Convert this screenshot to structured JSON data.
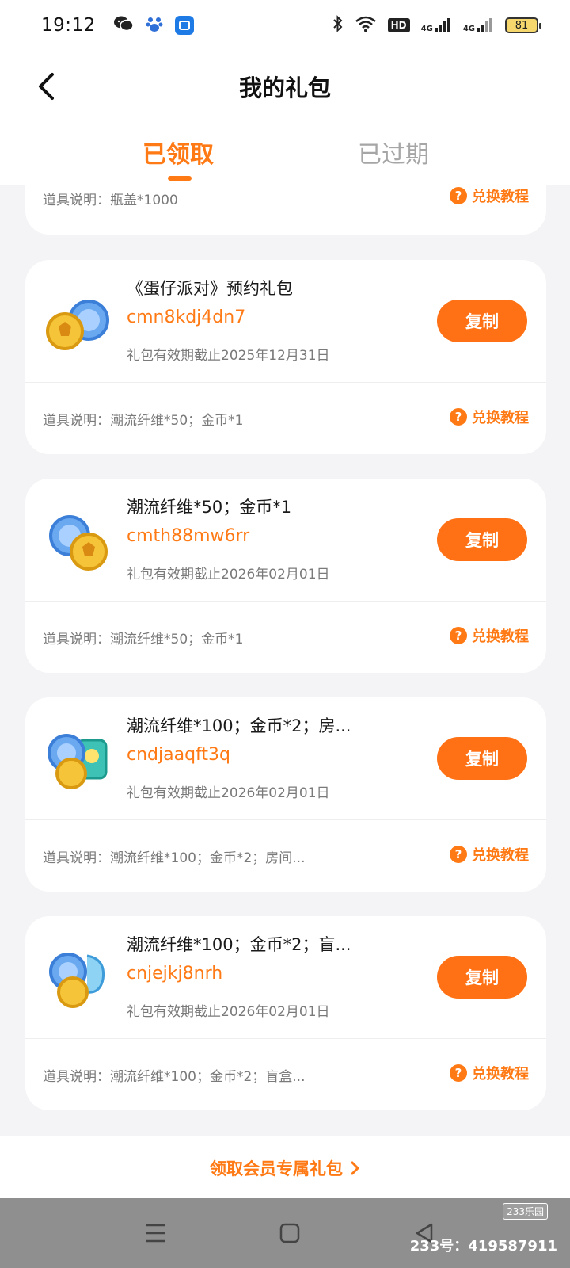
{
  "status_bar": {
    "time": "19:12",
    "battery": "81",
    "left_icons": [
      "wechat-icon",
      "paw-icon",
      "app-icon"
    ],
    "right_icons": [
      "bluetooth-icon",
      "wifi-icon",
      "hd-icon",
      "signal-4g-icon",
      "signal-4g-icon"
    ],
    "hd_label": "HD",
    "net1": "4G",
    "net2": "4G"
  },
  "header": {
    "title": "我的礼包",
    "tabs": [
      {
        "label": "已领取",
        "active": true
      },
      {
        "label": "已过期",
        "active": false
      }
    ]
  },
  "partial_card": {
    "item_desc": "道具说明：瓶盖*1000",
    "tutorial": "兑换教程"
  },
  "cards": [
    {
      "title": "《蛋仔派对》预约礼包",
      "code": "cmn8kdj4dn7",
      "expiry": "礼包有效期截止2025年12月31日",
      "copy": "复制",
      "item_desc": "道具说明：潮流纤维*50；金币*1",
      "tutorial": "兑换教程"
    },
    {
      "title": "潮流纤维*50；金币*1",
      "code": "cmth88mw6rr",
      "expiry": "礼包有效期截止2026年02月01日",
      "copy": "复制",
      "item_desc": "道具说明：潮流纤维*50；金币*1",
      "tutorial": "兑换教程"
    },
    {
      "title": "潮流纤维*100；金币*2；房...",
      "code": "cndjaaqft3q",
      "expiry": "礼包有效期截止2026年02月01日",
      "copy": "复制",
      "item_desc": "道具说明：潮流纤维*100；金币*2；房间...",
      "tutorial": "兑换教程"
    },
    {
      "title": "潮流纤维*100；金币*2；盲...",
      "code": "cnjejkj8nrh",
      "expiry": "礼包有效期截止2026年02月01日",
      "copy": "复制",
      "item_desc": "道具说明：潮流纤维*100；金币*2；盲盒...",
      "tutorial": "兑换教程"
    }
  ],
  "member_link": "领取会员专属礼包",
  "watermark": {
    "logo": "233乐园",
    "id": "233号：419587911"
  },
  "colors": {
    "accent": "#ff7a15",
    "button": "#ff7114",
    "background": "#f4f4f6",
    "nav": "#8f8f8f"
  }
}
